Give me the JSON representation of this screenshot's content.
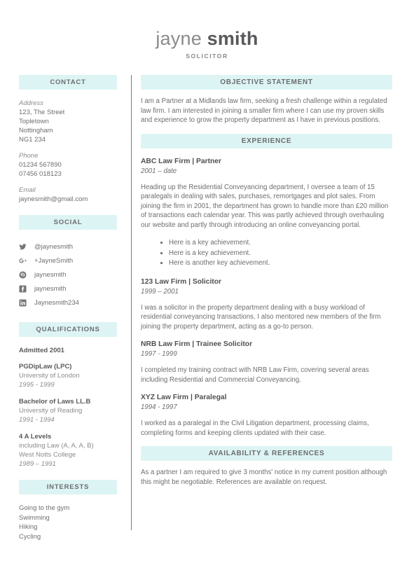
{
  "theme": {
    "bar_bg": "#ddf4f4",
    "text": "#6d6e70",
    "heading": "#58595b",
    "divider": "#7b7c7e"
  },
  "header": {
    "first_name": "jayne",
    "last_name": "smith",
    "job_title": "SOLICITOR"
  },
  "sidebar": {
    "contact": {
      "heading": "CONTACT",
      "address_label": "Address",
      "address_lines": [
        "123, The Street",
        "Topletown",
        "Nottingham",
        "NG1 234"
      ],
      "phone_label": "Phone",
      "phone_lines": [
        "01234 567890",
        "07456 018123"
      ],
      "email_label": "Email",
      "email": "jaynesmith@gmail.com"
    },
    "social": {
      "heading": "SOCIAL",
      "items": [
        {
          "icon": "twitter-icon",
          "handle": "@jaynesmith"
        },
        {
          "icon": "google-plus-icon",
          "handle": "+JayneSmith"
        },
        {
          "icon": "skype-icon",
          "handle": "jaynesmith"
        },
        {
          "icon": "facebook-icon",
          "handle": "jaynesmith"
        },
        {
          "icon": "linkedin-icon",
          "handle": "Jaynesmith234"
        }
      ]
    },
    "qualifications": {
      "heading": "QUALIFICATIONS",
      "admitted": "Admitted 2001",
      "items": [
        {
          "title": "PGDipLaw (LPC)",
          "institution": "University of London",
          "dates": "1995 - 1999"
        },
        {
          "title": "Bachelor of Laws LL.B",
          "institution": "University of Reading",
          "dates": "1991 - 1994"
        },
        {
          "title": "4 A Levels",
          "institution": "including Law (A, A, A, B)",
          "institution2": "West Notts College",
          "dates": "1989 – 1991"
        }
      ]
    },
    "interests": {
      "heading": "INTERESTS",
      "items": [
        "Going to the gym",
        "Swimming",
        "Hiking",
        "Cycling"
      ]
    }
  },
  "main": {
    "objective": {
      "heading": "OBJECTIVE STATEMENT",
      "body": "I am a Partner at a Midlands law firm, seeking a fresh challenge within a regulated law firm. I am interested in joining a smaller firm where I can use my proven skills and experience to grow the property department as I have in previous positions."
    },
    "experience": {
      "heading": "EXPERIENCE",
      "jobs": [
        {
          "title": "ABC Law Firm | Partner",
          "dates": "2001 – date",
          "body": "Heading up the Residential Conveyancing department, I oversee a team of 15 paralegals in dealing with sales, purchases, remortgages and plot sales. From joining the firm in 2001, the department has grown to handle more than £20 million of transactions each calendar year. This was partly achieved through overhauling our website and partly through introducing an online conveyancing portal.",
          "bullets": [
            "Here is a key achievement.",
            "Here is a key achievement.",
            "Here is another key achievement."
          ]
        },
        {
          "title": "123 Law Firm | Solicitor",
          "dates": "1999 – 2001",
          "body": "I was a solicitor in the property department dealing with a busy workload of residential conveyancing transactions. I also mentored new members of the firm joining the property department, acting as a go-to person.",
          "bullets": []
        },
        {
          "title": "NRB Law Firm | Trainee Solicitor",
          "dates": "1997 - 1999",
          "body": "I completed my training contract with NRB Law Firm, covering several areas including Residential and Commercial Conveyancing.",
          "bullets": []
        },
        {
          "title": "XYZ Law Firm | Paralegal",
          "dates": "1994 - 1997",
          "body": "I worked as a paralegal in the Civil Litigation department, processing claims, completing forms and keeping clients updated with their case.",
          "bullets": []
        }
      ]
    },
    "availability": {
      "heading": "AVAILABILITY & REFERENCES",
      "body": "As a partner I am required to give 3 months' notice in my current position although this might be negotiable. References are available on request."
    }
  }
}
